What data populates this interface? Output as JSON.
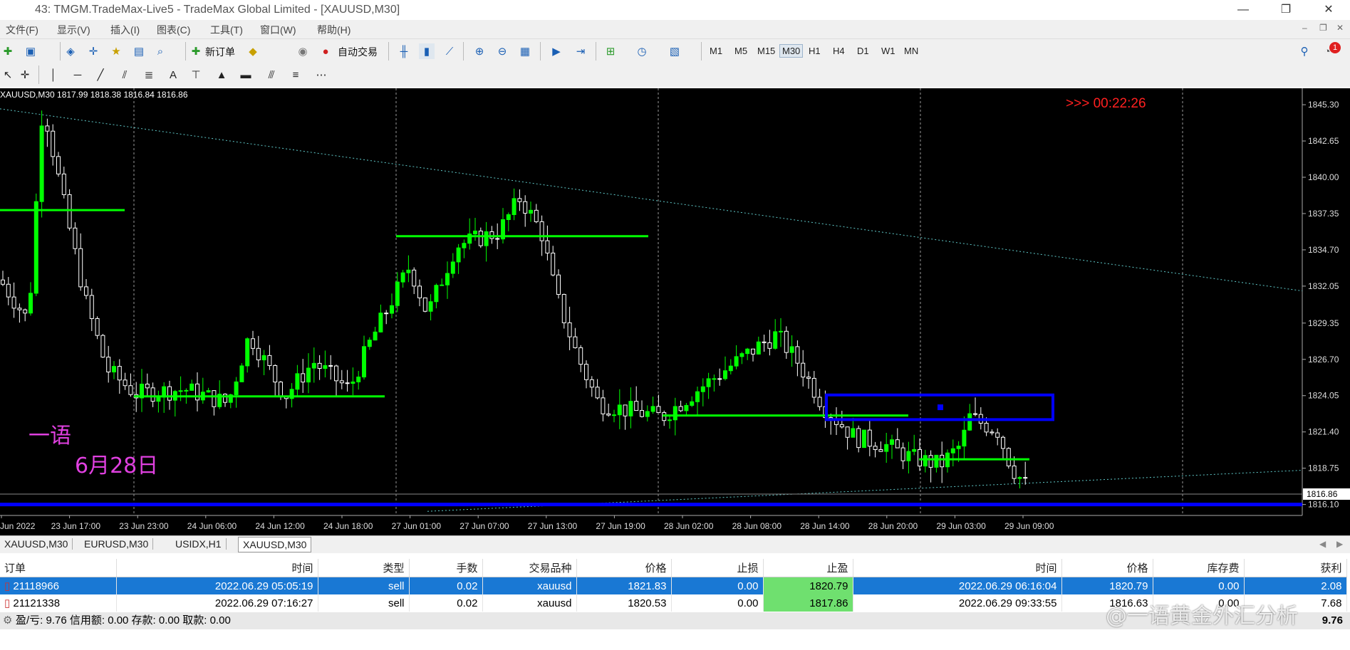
{
  "window": {
    "title": "43: TMGM.TradeMax-Live5 - TradeMax Global Limited - [XAUUSD,M30]",
    "controls": [
      "—",
      "❐",
      "✕"
    ]
  },
  "menu": [
    "文件(F)",
    "显示(V)",
    "插入(I)",
    "图表(C)",
    "工具(T)",
    "窗口(W)",
    "帮助(H)"
  ],
  "toolbar": {
    "new_order": "新订单",
    "auto_trade": "自动交易",
    "timeframes": [
      "M1",
      "M5",
      "M15",
      "M30",
      "H1",
      "H4",
      "D1",
      "W1",
      "MN"
    ],
    "selected_timeframe": "M30",
    "notification_count": "1"
  },
  "chart_data": {
    "type": "candlestick",
    "symbol_info": "XAUUSD,M30  1817.99 1818.38 1816.84 1816.86",
    "countdown": ">>> 00:22:26",
    "current_price": "1816.86",
    "price_labels": [
      "1845.30",
      "1842.65",
      "1840.00",
      "1837.35",
      "1834.70",
      "1832.05",
      "1829.35",
      "1826.70",
      "1824.05",
      "1821.40",
      "1818.75",
      "1816.10"
    ],
    "ylim": [
      1815.3,
      1846.5
    ],
    "time_labels": [
      "Jun 2022",
      "23 Jun 17:00",
      "23 Jun 23:00",
      "24 Jun 06:00",
      "24 Jun 12:00",
      "24 Jun 18:00",
      "27 Jun 01:00",
      "27 Jun 07:00",
      "27 Jun 13:00",
      "27 Jun 19:00",
      "28 Jun 02:00",
      "28 Jun 08:00",
      "28 Jun 14:00",
      "28 Jun 20:00",
      "29 Jun 03:00",
      "29 Jun 09:00"
    ],
    "annotation_name": "一语",
    "annotation_date": "6月28日",
    "key_levels": [
      1837.6,
      1835.7,
      1824.0,
      1822.6,
      1819.4
    ],
    "support_level": 1816.1,
    "resistance_rect": [
      1822.3,
      1824.1
    ],
    "colors": {
      "bull": "#00ff00",
      "bear": "#ffffff",
      "level": "#00ff00",
      "support": "#0000ff",
      "trend": "#5fc8c8",
      "countdown": "#ff2020",
      "annotation": "#e040e0"
    }
  },
  "tabs": {
    "items": [
      "XAUUSD,M30",
      "EURUSD,M30",
      "USIDX,H1",
      "XAUUSD,M30"
    ],
    "active": 3
  },
  "orders": {
    "headers": [
      "订单",
      "时间",
      "类型",
      "手数",
      "交易品种",
      "价格",
      "止损",
      "止盈",
      "时间",
      "价格",
      "库存费",
      "获利"
    ],
    "rows": [
      [
        "21118966",
        "2022.06.29 05:05:19",
        "sell",
        "0.02",
        "xauusd",
        "1821.83",
        "0.00",
        "1820.79",
        "2022.06.29 06:16:04",
        "1820.79",
        "0.00",
        "2.08"
      ],
      [
        "21121338",
        "2022.06.29 07:16:27",
        "sell",
        "0.02",
        "xauusd",
        "1820.53",
        "0.00",
        "1817.86",
        "2022.06.29 09:33:55",
        "1816.63",
        "0.00",
        "7.68"
      ]
    ],
    "summary": "盈/亏: 9.76  信用额: 0.00  存款: 0.00  取款: 0.00",
    "total": "9.76"
  },
  "watermark": "@一语黄金外汇分析"
}
